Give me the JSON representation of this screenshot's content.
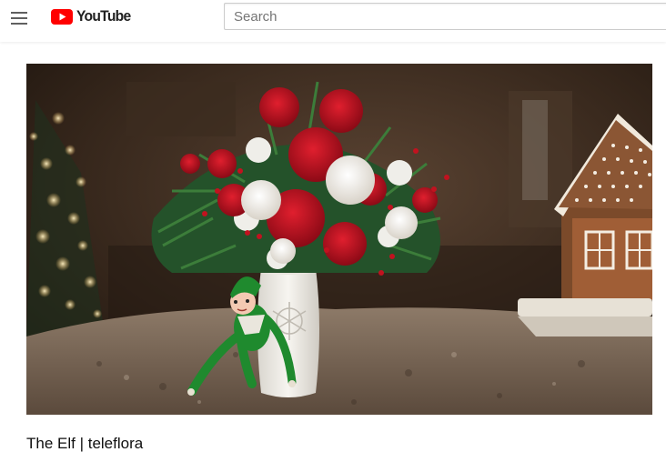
{
  "header": {
    "menu_icon": "hamburger-menu-icon",
    "logo_text": "YouTube",
    "logo_color": "#ff0000",
    "search": {
      "placeholder": "Search",
      "value": ""
    }
  },
  "video": {
    "title": "The Elf | teleflora",
    "thumbnail_description": "elf-doll-beside-flower-vase-with-gingerbread-house"
  }
}
